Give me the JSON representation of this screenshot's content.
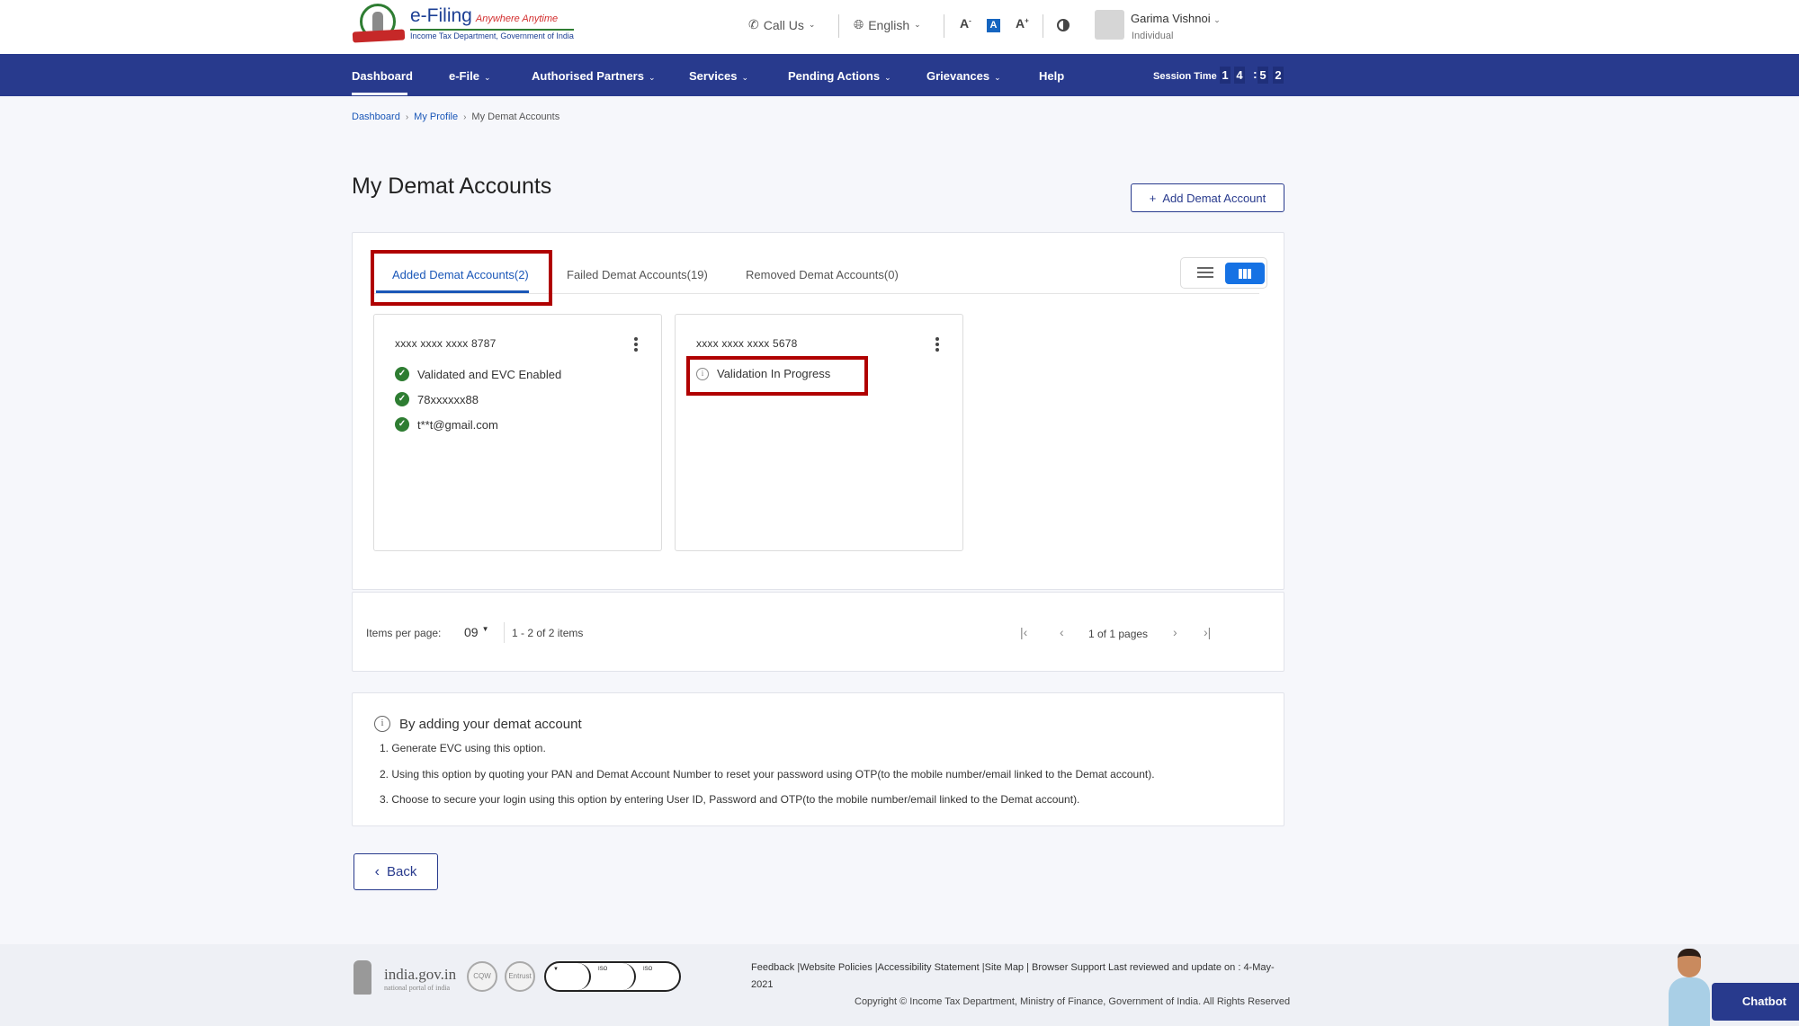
{
  "header": {
    "logo": {
      "title": "e-Filing",
      "tagline": "Anywhere Anytime",
      "subtitle": "Income Tax Department, Government of India"
    },
    "call_us": "Call Us",
    "language": "English",
    "font_controls": {
      "decrease": "A",
      "normal": "A",
      "increase": "A"
    },
    "user": {
      "name": "Garima Vishnoi",
      "role": "Individual"
    }
  },
  "nav": {
    "items": [
      {
        "label": "Dashboard",
        "active": true,
        "dropdown": false
      },
      {
        "label": "e-File",
        "dropdown": true
      },
      {
        "label": "Authorised Partners",
        "dropdown": true
      },
      {
        "label": "Services",
        "dropdown": true
      },
      {
        "label": "Pending Actions",
        "dropdown": true
      },
      {
        "label": "Grievances",
        "dropdown": true
      },
      {
        "label": "Help",
        "dropdown": false
      }
    ],
    "session": {
      "label": "Session Time",
      "digits": [
        "1",
        "4",
        "5",
        "2"
      ],
      "separator": ":"
    }
  },
  "breadcrumb": {
    "items": [
      "Dashboard",
      "My Profile"
    ],
    "current": "My Demat Accounts",
    "separator": "›"
  },
  "page": {
    "title": "My Demat Accounts",
    "add_button": {
      "icon": "+",
      "label": "Add Demat Account"
    }
  },
  "tabs": [
    {
      "label": "Added Demat Accounts(2)",
      "active": true
    },
    {
      "label": "Failed Demat Accounts(19)",
      "active": false
    },
    {
      "label": "Removed Demat Accounts(0)",
      "active": false
    }
  ],
  "view_toggle": {
    "selected": "grid",
    "options": [
      "list",
      "grid"
    ]
  },
  "accounts": [
    {
      "number": "xxxx xxxx xxxx 8787",
      "statuses": [
        {
          "type": "check",
          "text": "Validated and EVC Enabled"
        },
        {
          "type": "check",
          "text": "78xxxxxx88"
        },
        {
          "type": "check",
          "text": "t**t@gmail.com"
        }
      ]
    },
    {
      "number": "xxxx xxxx xxxx 5678",
      "statuses": [
        {
          "type": "info",
          "text": "Validation In Progress"
        }
      ]
    }
  ],
  "pagination": {
    "items_per_page_label": "Items per page:",
    "items_per_page": "09",
    "range": "1 - 2 of 2 items",
    "page_info": "1 of 1 pages"
  },
  "info": {
    "heading": "By adding your demat account",
    "points": [
      "1. Generate EVC using this option.",
      "2. Using this option by quoting your PAN and Demat Account Number to reset your password using OTP(to the mobile number/email linked to the Demat account).",
      "3. Choose to secure your login using this option by entering User ID, Password and OTP(to the mobile number/email linked to the Demat account)."
    ]
  },
  "back_button": {
    "label": "Back"
  },
  "footer": {
    "india_gov": "india.gov.in",
    "india_gov_sub": "national portal of india",
    "badges": [
      "CQW",
      "Entrust"
    ],
    "links": "Feedback |Website Policies |Accessibility Statement |Site Map | Browser Support   Last reviewed and update on : 4-May-",
    "year": "2021",
    "copyright": "Copyright © Income Tax Department, Ministry of Finance, Government of India. All Rights Reserved",
    "chatbot": "Chatbot"
  },
  "colors": {
    "nav_bg": "#283a8d",
    "accent": "#1a57b8",
    "success": "#2e7d32",
    "highlight": "#b00000",
    "toggle_active": "#1672e4"
  }
}
